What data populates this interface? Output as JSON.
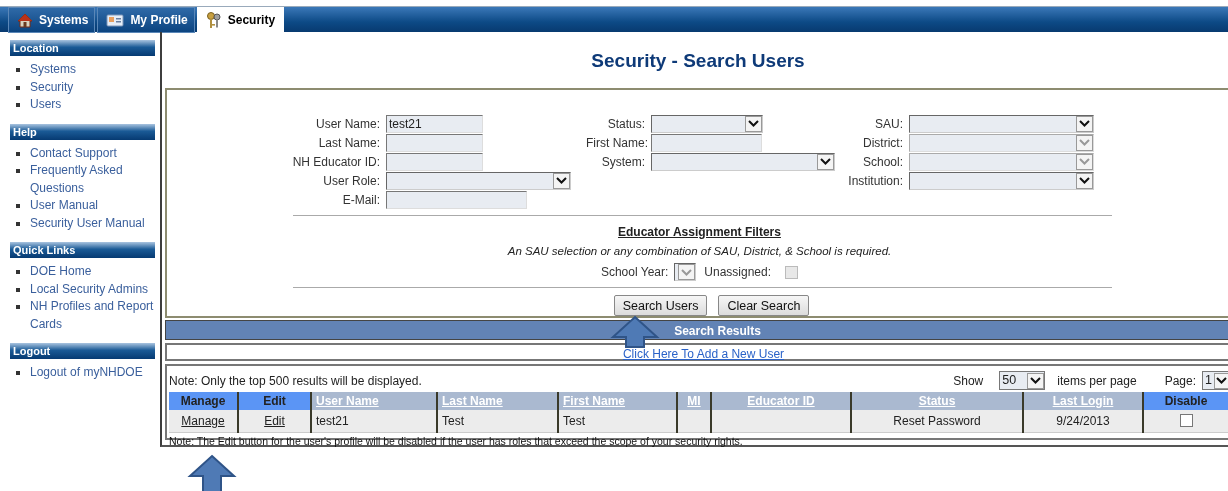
{
  "nav_tabs": [
    {
      "label": "Systems",
      "kind": "home",
      "selected": false
    },
    {
      "label": "My Profile",
      "kind": "profile",
      "selected": false
    },
    {
      "label": "Security",
      "kind": "keys",
      "selected": true
    }
  ],
  "sidebar": {
    "sections": [
      {
        "title": "Location",
        "items": [
          "Systems",
          "Security",
          "Users"
        ]
      },
      {
        "title": "Help",
        "items": [
          "Contact Support",
          "Frequently Asked Questions",
          "User Manual",
          "Security User Manual"
        ]
      },
      {
        "title": "Quick Links",
        "items": [
          "DOE Home",
          "Local Security Admins",
          "NH Profiles and Report Cards"
        ]
      },
      {
        "title": "Logout",
        "items": [
          "Logout of myNHDOE"
        ]
      }
    ]
  },
  "page_title": "Security - Search Users",
  "form": {
    "columns": [
      [
        {
          "label": "User Name:",
          "kind": "text",
          "value": "test21"
        },
        {
          "label": "Last Name:",
          "kind": "text"
        },
        {
          "label": "NH Educator ID:",
          "kind": "text"
        },
        {
          "label": "User Role:",
          "kind": "select",
          "disabled": false
        },
        {
          "label": "E-Mail:",
          "kind": "text"
        }
      ],
      [
        {
          "label": "Status:",
          "kind": "select",
          "disabled": false
        },
        {
          "label": "First Name:",
          "kind": "text"
        },
        {
          "label": "System:",
          "kind": "select",
          "disabled": false
        }
      ],
      [
        {
          "label": "SAU:",
          "kind": "select",
          "disabled": false
        },
        {
          "label": "District:",
          "kind": "select",
          "disabled": true
        },
        {
          "label": "School:",
          "kind": "select",
          "disabled": true
        },
        {
          "label": "Institution:",
          "kind": "select",
          "disabled": false
        }
      ]
    ],
    "filters": {
      "title": "Educator Assignment Filters",
      "note": "An SAU selection or any combination of SAU, District, & School is required.",
      "school_year": {
        "label": "School Year:",
        "disabled": true
      },
      "unassigned": {
        "label": "Unassigned:",
        "checked": false,
        "disabled": true
      }
    },
    "buttons": [
      "Search Users",
      "Clear Search"
    ]
  },
  "results": {
    "header": "Search Results",
    "add_link": "Click Here To Add a New User",
    "note": "Note: Only the top 500 results will be displayed.",
    "show": {
      "label": "Show",
      "value": "50",
      "suffix": "items per page"
    },
    "page": {
      "label": "Page:",
      "value": "1"
    },
    "columns": [
      {
        "label": "Manage",
        "kind": "action"
      },
      {
        "label": "Edit",
        "kind": "action"
      },
      {
        "label": "User Name",
        "kind": "sortable"
      },
      {
        "label": "Last Name",
        "kind": "sortable"
      },
      {
        "label": "First Name",
        "kind": "sortable"
      },
      {
        "label": "MI",
        "kind": "sortable"
      },
      {
        "label": "Educator ID",
        "kind": "sortable"
      },
      {
        "label": "Status",
        "kind": "sortable"
      },
      {
        "label": "Last Login",
        "kind": "sortable"
      },
      {
        "label": "Disable",
        "kind": "action"
      }
    ],
    "rows": [
      {
        "manage": "Manage",
        "edit": "Edit",
        "user_name": "test21",
        "last_name": "Test",
        "first_name": "Test",
        "status": "Reset Password",
        "last_login": "9/24/2013",
        "disabled": false
      }
    ],
    "footer_note": "Note: The Edit button for the user's profile will be disabled if the user has roles that exceed the scope of your security rights."
  }
}
